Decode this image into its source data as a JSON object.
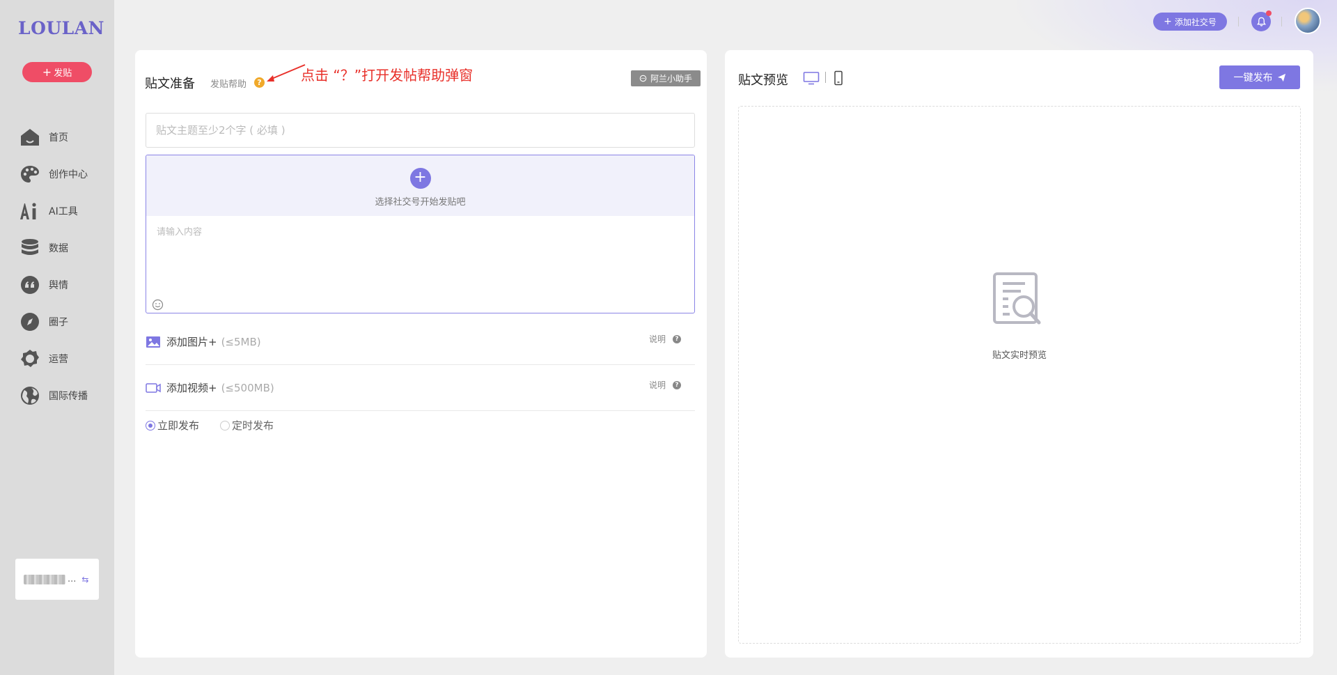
{
  "sidebar": {
    "logo": "LOULAN",
    "post_button": "发贴",
    "nav": [
      {
        "label": "首页",
        "icon": "home-icon"
      },
      {
        "label": "创作中心",
        "icon": "palette-icon"
      },
      {
        "label": "AI工具",
        "icon": "ai-icon"
      },
      {
        "label": "数据",
        "icon": "database-icon"
      },
      {
        "label": "舆情",
        "icon": "quote-icon"
      },
      {
        "label": "圈子",
        "icon": "compass-icon"
      },
      {
        "label": "运营",
        "icon": "cog-icon"
      },
      {
        "label": "国际传播",
        "icon": "globe-icon"
      }
    ],
    "account_suffix": "..."
  },
  "topbar": {
    "add_account": "添加社交号"
  },
  "left_panel": {
    "title": "贴文准备",
    "help_label": "发贴帮助",
    "help_icon_text": "?",
    "annotation": "点击 “？”打开发帖帮助弹窗",
    "assistant_button": "阿兰小助手",
    "topic_placeholder": "贴文主题至少2个字 ( 必填 )",
    "select_account": "选择社交号开始发贴吧",
    "content_placeholder": "请输入内容",
    "add_image": "添加图片+",
    "image_limit": "(≤5MB)",
    "add_video": "添加视频+",
    "video_limit": "(≤500MB)",
    "explain": "说明",
    "publish_now": "立即发布",
    "publish_scheduled": "定时发布"
  },
  "right_panel": {
    "title": "贴文预览",
    "publish_button": "一键发布",
    "preview_text": "贴文实时预览"
  },
  "colors": {
    "accent": "#7e77e2",
    "danger": "#ef4d66",
    "annotation": "#e8302a",
    "help": "#f0a92a"
  }
}
